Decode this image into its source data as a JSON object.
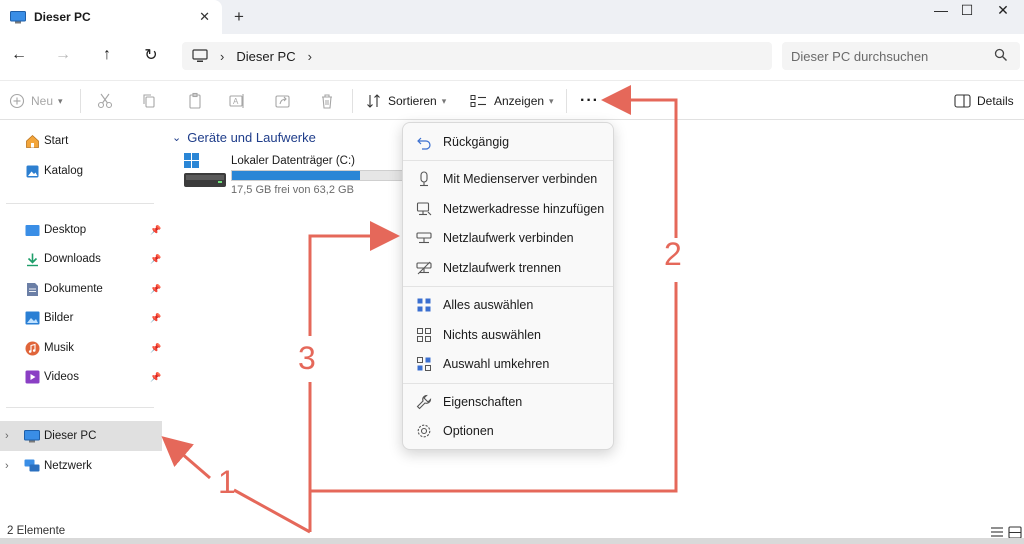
{
  "window": {
    "tab_title": "Dieser PC",
    "tab_close": "✕",
    "new_tab": "+",
    "minimize": "—",
    "maximize": "☐",
    "close": "✕"
  },
  "nav": {
    "back": "←",
    "forward": "→",
    "up": "↑",
    "refresh": "↻"
  },
  "address": {
    "separator": "›",
    "crumb": "Dieser PC",
    "trailing_separator": "›"
  },
  "search": {
    "placeholder": "Dieser PC durchsuchen"
  },
  "commandbar": {
    "new_label": "Neu",
    "sort_label": "Sortieren",
    "view_label": "Anzeigen",
    "more_label": "···",
    "details_label": "Details"
  },
  "sidebar": {
    "items": [
      {
        "label": "Start"
      },
      {
        "label": "Katalog"
      },
      {
        "label": "Desktop"
      },
      {
        "label": "Downloads"
      },
      {
        "label": "Dokumente"
      },
      {
        "label": "Bilder"
      },
      {
        "label": "Musik"
      },
      {
        "label": "Videos"
      },
      {
        "label": "Dieser PC"
      },
      {
        "label": "Netzwerk"
      }
    ]
  },
  "content": {
    "group_title": "Geräte und Laufwerke",
    "drive": {
      "name": "Lokaler Datenträger (C:)",
      "free_text": "17,5 GB frei von 63,2 GB",
      "used_fraction": 0.72
    }
  },
  "menu": {
    "items": [
      {
        "label": "Rückgängig"
      },
      {
        "label": "Mit Medienserver verbinden"
      },
      {
        "label": "Netzwerkadresse hinzufügen"
      },
      {
        "label": "Netzlaufwerk verbinden"
      },
      {
        "label": "Netzlaufwerk trennen"
      },
      {
        "label": "Alles auswählen"
      },
      {
        "label": "Nichts auswählen"
      },
      {
        "label": "Auswahl umkehren"
      },
      {
        "label": "Eigenschaften"
      },
      {
        "label": "Optionen"
      }
    ]
  },
  "status": {
    "count": "2 Elemente"
  },
  "annotations": {
    "one": "1",
    "two": "2",
    "three": "3",
    "color": "#e5685a"
  },
  "colors": {
    "accent": "#2a86d6",
    "group_title": "#1f3d8a",
    "selection": "#e0e0e0"
  }
}
